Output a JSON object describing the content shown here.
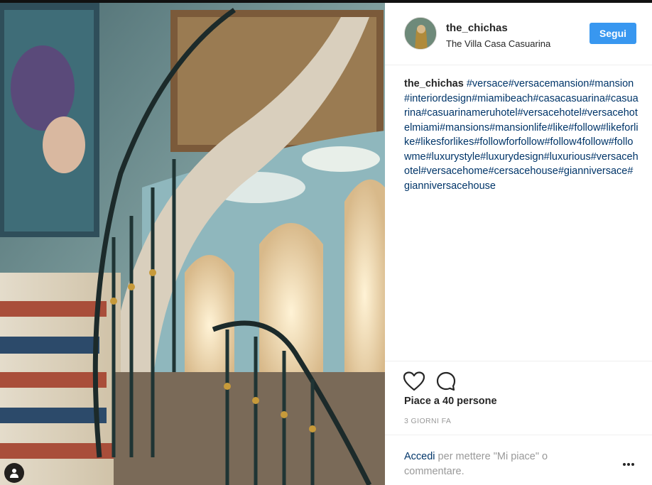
{
  "post": {
    "username": "the_chichas",
    "location": "The Villa Casa Casuarina",
    "follow_label": "Segui",
    "caption_user": "the_chichas",
    "caption_text": "#versace#versacemansion#mansion#interiordesign#miamibeach#casacasuarina#casuarina#casuarinameruhotel#versacehotel#versacehotelmiami#mansions#mansionlife#like#follow#likeforlike#likesforlikes#followforfollow#follow4follow#followme#luxurystyle#luxurydesign#luxurious#versacehotel#versacehome#cersacehouse#gianniversace#gianniversacehouse",
    "likes": "Piace a 40 persone",
    "time": "3 GIORNI FA",
    "login_link": "Accedi",
    "login_rest": " per mettere \"Mi piace\" o commentare."
  },
  "icons": {
    "like": "heart-outline-icon",
    "comment": "speech-bubble-icon",
    "more": "ellipsis-icon",
    "user_tag": "person-icon"
  },
  "colors": {
    "follow_button": "#3897f0",
    "link": "#003569",
    "muted": "#999999"
  }
}
